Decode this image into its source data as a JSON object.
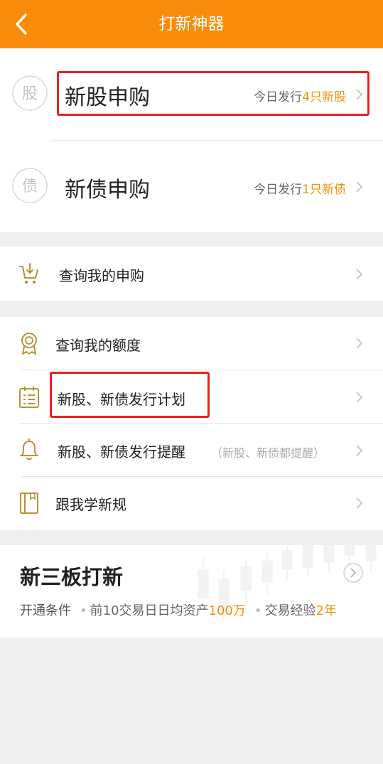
{
  "header": {
    "title": "打新神器",
    "back_icon": "chevron-left-icon"
  },
  "subscriptions": [
    {
      "icon_char": "股",
      "title": "新股申购",
      "desc_prefix": "今日发行",
      "desc_highlight": "4只新股"
    },
    {
      "icon_char": "债",
      "title": "新债申购",
      "desc_prefix": "今日发行",
      "desc_highlight": "1只新债"
    }
  ],
  "query": {
    "label": "查询我的申购",
    "icon": "cart-download-icon"
  },
  "menu": [
    {
      "label": "查询我的额度",
      "icon": "medal-icon",
      "note": ""
    },
    {
      "label": "新股、新债发行计划",
      "icon": "calendar-list-icon",
      "note": ""
    },
    {
      "label": "新股、新债发行提醒",
      "icon": "bell-icon",
      "note": "（新股、新债都提醒）"
    },
    {
      "label": "跟我学新规",
      "icon": "book-icon",
      "note": ""
    }
  ],
  "sanban": {
    "title": "新三板打新",
    "condition_label": "开通条件",
    "cond1_prefix": "前10交易日日均资产",
    "cond1_value": "100万",
    "cond2_prefix": "交易经验",
    "cond2_value": "2年"
  },
  "colors": {
    "accent": "#f98c0b",
    "highlight": "#f0910d",
    "annotation": "#e9201f",
    "icon_gold": "#b8923a"
  }
}
